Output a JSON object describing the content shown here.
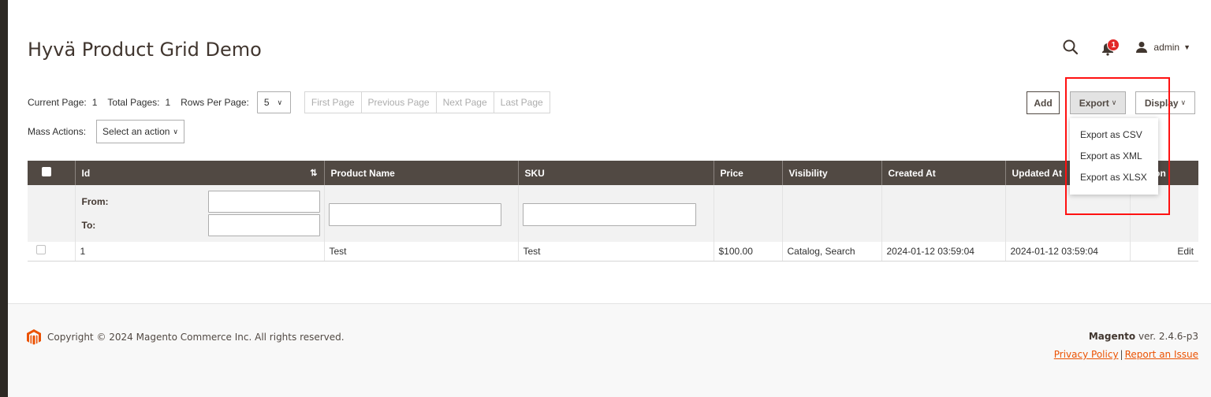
{
  "page": {
    "title": "Hyvä Product Grid Demo"
  },
  "header": {
    "user_name": "admin",
    "notification_count": "1"
  },
  "pager": {
    "current_page_label": "Current Page:",
    "current_page": "1",
    "total_pages_label": "Total Pages:",
    "total_pages": "1",
    "rows_per_page_label": "Rows Per Page:",
    "rows_per_page": "5",
    "buttons": [
      "First Page",
      "Previous Page",
      "Next Page",
      "Last Page"
    ]
  },
  "mass_actions": {
    "label": "Mass Actions:",
    "selected": "Select an action"
  },
  "toolbar": {
    "add_label": "Add",
    "export_label": "Export",
    "display_label": "Display"
  },
  "export_menu": {
    "items": [
      "Export as CSV",
      "Export as XML",
      "Export as XLSX"
    ]
  },
  "grid": {
    "columns": [
      "Id",
      "Product Name",
      "SKU",
      "Price",
      "Visibility",
      "Created At",
      "Updated At",
      "Action"
    ],
    "filter": {
      "from_label": "From:",
      "to_label": "To:"
    },
    "rows": [
      {
        "id": "1",
        "name": "Test",
        "sku": "Test",
        "price": "$100.00",
        "visibility": "Catalog, Search",
        "created": "2024-01-12 03:59:04",
        "updated": "2024-01-12 03:59:04",
        "action": "Edit"
      }
    ]
  },
  "footer": {
    "copyright": "Copyright © 2024 Magento Commerce Inc. All rights reserved.",
    "brand": "Magento",
    "version": " ver. 2.4.6-p3",
    "privacy_link": "Privacy Policy",
    "separator": "|",
    "report_link": "Report an Issue"
  },
  "colors": {
    "header_bg": "#514943",
    "accent_link": "#eb5202",
    "badge": "#e22626",
    "highlight": "#ff1111"
  }
}
